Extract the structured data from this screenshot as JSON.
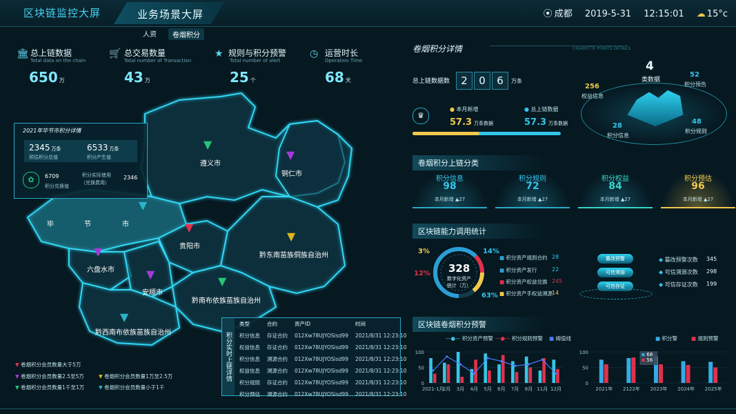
{
  "header": {
    "title": "区块链监控大屏",
    "active_tab": "业务场景大屏",
    "city": "成都",
    "date": "2019-5-31",
    "time": "12:15:01",
    "temp": "15°c",
    "subtabs": [
      "人资",
      "卷烟积分"
    ]
  },
  "stats": [
    {
      "icon": "bank-icon",
      "title": "总上链数据",
      "subtitle": "Total data on the chain",
      "value": "650",
      "unit": "万"
    },
    {
      "icon": "cart-icon",
      "title": "总交易数量",
      "subtitle": "Total number of Transaction",
      "value": "43",
      "unit": "万"
    },
    {
      "icon": "star-icon",
      "title": "规则与积分预警",
      "subtitle": "Total number of alert",
      "value": "25",
      "unit": "个"
    },
    {
      "icon": "clock-icon",
      "title": "运营时长",
      "subtitle": "Operation Time",
      "value": "68",
      "unit": "天"
    }
  ],
  "bijie_panel": {
    "title": "2021年毕节市积分详情",
    "a_value": "2345",
    "a_unit": "万条",
    "a_label": "预估积分总值",
    "b_value": "6533",
    "b_unit": "万条",
    "b_label": "积分产生值",
    "c_value": "6709",
    "c_label": "积分兑换值",
    "d_label1": "积分实际使用",
    "d_label2": "（兑换费用）",
    "d_value": "2346"
  },
  "map_labels": [
    {
      "name": "遵义市"
    },
    {
      "name": "铜仁市"
    },
    {
      "name": "毕"
    },
    {
      "name": "节"
    },
    {
      "name": "市"
    },
    {
      "name": "贵阳市"
    },
    {
      "name": "黔东南苗族侗族自治州"
    },
    {
      "name": "六盘水市"
    },
    {
      "name": "安顺市"
    },
    {
      "name": "黔南布依族苗族自治州"
    },
    {
      "name": "黔西南布依族苗族自治州"
    }
  ],
  "legend": [
    {
      "label": "卷烟积分会员数量大于5万",
      "color": "#e0314c"
    },
    {
      "label": "卷烟积分会员数量2.5至5万",
      "color": "#a23bd6"
    },
    {
      "label": "卷烟积分会员数量1万至2.5万",
      "color": "#d9b51d"
    },
    {
      "label": "卷烟积分会员数量1千至1万",
      "color": "#27c47a"
    },
    {
      "label": "卷烟积分会员数量小于1千",
      "color": "#29b3c8"
    }
  ],
  "realtime": {
    "title": "积分实时上链详情",
    "columns": [
      "类型",
      "合约",
      "资产ID",
      "时间"
    ],
    "rows": [
      [
        "积分信息",
        "存证合约",
        "012Xw78UJYOSisd99",
        "2021/8/31 12:23:10"
      ],
      [
        "权益信息",
        "存证合约",
        "012Xw78UJYOSisd99",
        "2021/8/31 12:23:10"
      ],
      [
        "积分信息",
        "溯源合约",
        "012Xw78UJYOSisd99",
        "2021/8/31 12:23:10"
      ],
      [
        "权益信息",
        "溯源合约",
        "012Xw78UJYOSisd99",
        "2021/8/31 12:23:10"
      ],
      [
        "积分规则",
        "存证合约",
        "012Xw78UJYOSisd99",
        "2021/8/31 12:23:10"
      ],
      [
        "积分预估",
        "溯源合约",
        "012Xw78UJYOSisd99",
        "2021/8/31 12:23:10"
      ]
    ]
  },
  "detail": {
    "title": "卷烟积分详情",
    "title_en": "CIGARETTE POINTS DETAILS",
    "total_label": "总上链数据数",
    "digits": [
      "2",
      "0",
      "6"
    ],
    "digits_unit": "万条",
    "new_label": "本月新增",
    "new_value": "57.3",
    "new_unit": "万条数据",
    "total2_label": "总上链数据",
    "total2_value": "57.3",
    "total2_unit": "万条数据",
    "ring_center": "4",
    "ring_center_label": "类数据",
    "ring_items": [
      {
        "value": "256",
        "label": "权益信息"
      },
      {
        "value": "52",
        "label": "积分预告"
      },
      {
        "value": "28",
        "label": "积分信息"
      },
      {
        "value": "48",
        "label": "积分规则"
      }
    ]
  },
  "categories": {
    "title": "卷烟积分上链分类",
    "items": [
      {
        "name": "积分信息",
        "value": "98",
        "new_label": "本月新增",
        "new_value": "27",
        "color": "#33c4ea"
      },
      {
        "name": "积分规则",
        "value": "72",
        "new_label": "本月新增",
        "new_value": "27",
        "color": "#33c4ea"
      },
      {
        "name": "积分权益",
        "value": "84",
        "new_label": "本月新增",
        "new_value": "27",
        "color": "#35d6c9"
      },
      {
        "name": "积分预估",
        "value": "96",
        "new_label": "本月新增",
        "new_value": "27",
        "color": "#f2c94c"
      }
    ]
  },
  "capability": {
    "title": "区块链能力调用统计",
    "center_value": "328",
    "center_label1": "数字化资产",
    "center_label2": "统计（万）",
    "pcts": [
      "3%",
      "14%",
      "12%",
      "63%"
    ],
    "items": [
      {
        "label": "积分资产规则合约",
        "value": "28",
        "color": "#2a9fd6"
      },
      {
        "label": "积分资产发行",
        "value": "22",
        "color": "#2a9fd6"
      },
      {
        "label": "积分资产权益兑换",
        "value": "245",
        "color": "#e0314c"
      },
      {
        "label": "积分资产手权益溯源",
        "value": "14",
        "color": "#f2c94c"
      }
    ],
    "stack_labels": [
      "篡改预警",
      "可信溯源",
      "可信存证"
    ],
    "right_items": [
      {
        "label": "篡改预警次数",
        "value": "345"
      },
      {
        "label": "可信溯源次数",
        "value": "298"
      },
      {
        "label": "可信存证次数",
        "value": "199"
      }
    ]
  },
  "warning": {
    "title": "区块链卷烟积分预警",
    "chart_data": [
      {
        "type": "bar",
        "categories": [
          "2021-1月",
          "2月",
          "3月",
          "4月",
          "5月",
          "6月",
          "7月",
          "8月",
          "11月",
          "12月"
        ],
        "series": [
          {
            "name": "积分资产预警",
            "color": "#38c6e6",
            "values": [
              80,
              65,
              100,
              45,
              95,
              60,
              70,
              85,
              40,
              75
            ]
          },
          {
            "name": "积分规则预警",
            "color": "#e0314c",
            "values": [
              30,
              60,
              20,
              75,
              40,
              90,
              35,
              50,
              80,
              45
            ]
          }
        ],
        "line": {
          "name": "阈值线",
          "color": "#4a7bff",
          "values": [
            40,
            85,
            60,
            30,
            80,
            70,
            55,
            60,
            75,
            30
          ]
        },
        "yticks": [
          "100",
          "50",
          "0"
        ],
        "ylim": [
          0,
          120
        ]
      },
      {
        "type": "bar",
        "categories": [
          "2021年",
          "2122年",
          "2023年",
          "2024年",
          "2025年"
        ],
        "series": [
          {
            "name": "积分警",
            "color": "#38a9e6",
            "values": [
              75,
              80,
              85,
              70,
              68
            ]
          },
          {
            "name": "规则预警",
            "color": "#e0314c",
            "values": [
              60,
              82,
              60,
              58,
              50
            ]
          }
        ],
        "tooltip": [
          "68",
          "56"
        ],
        "yticks": [
          "100",
          "50",
          "0"
        ],
        "ylim": [
          0,
          120
        ]
      }
    ]
  }
}
